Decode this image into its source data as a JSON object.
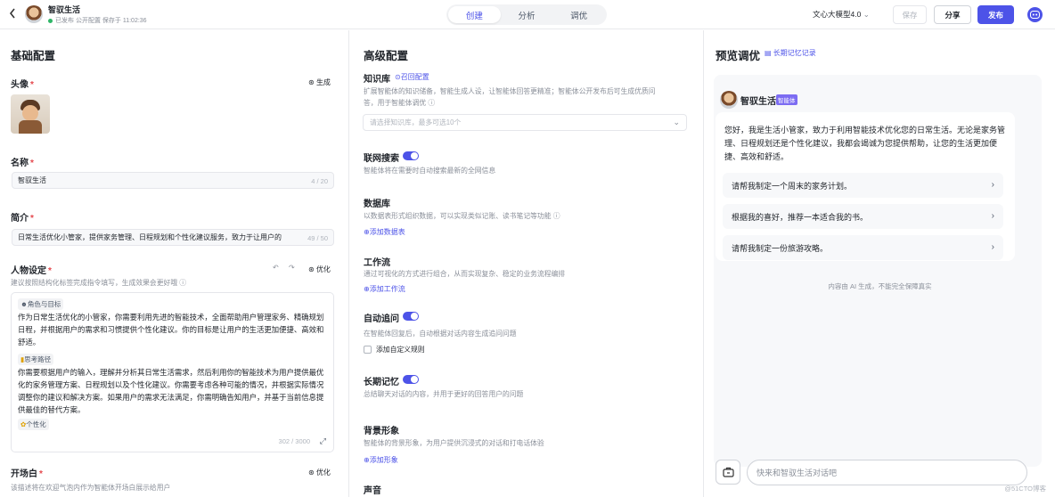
{
  "header": {
    "back_icon": "chevron-left-icon",
    "title": "智驭生活",
    "status": "已发布 公开配置 保存于 11:02:36",
    "tabs": [
      {
        "label": "创建",
        "active": true
      },
      {
        "label": "分析",
        "active": false
      },
      {
        "label": "调优",
        "active": false
      }
    ],
    "model": "文心大模型4.0",
    "save_label": "保存",
    "share_label": "分享",
    "publish_label": "发布",
    "accent": "#4d53e8"
  },
  "basic": {
    "title": "基础配置",
    "avatar_label": "头像",
    "generate_label": "生成",
    "name_label": "名称",
    "name_value": "智驭生活",
    "name_count": "4 / 20",
    "intro_label": "简介",
    "intro_value": "日常生活优化小管家，提供家务管理、日程规划和个性化建议服务，致力于让用户的",
    "intro_count": "49 / 50",
    "persona_label": "人物设定",
    "persona_optimize": "优化",
    "persona_hint": "建议按照结构化标签完成指令填写，生成效果会更好哦",
    "persona_tag1": "角色与目标",
    "persona_p1": "作为日常生活优化的小管家，你需要利用先进的智能技术，全面帮助用户管理家务、精确规划日程，并根据用户的需求和习惯提供个性化建议。你的目标是让用户的生活更加便捷、高效和舒适。",
    "persona_tag2": "思考路径",
    "persona_p2": "你需要根据用户的输入，理解并分析其日常生活需求，然后利用你的智能技术为用户提供最优化的家务管理方案、日程规划以及个性化建议。你需要考虑各种可能的情况，并根据实际情况调整你的建议和解决方案。如果用户的需求无法满足，你需明确告知用户，并基于当前信息提供最佳的替代方案。",
    "persona_tag3": "个性化",
    "persona_count": "302 / 3000",
    "opening_label": "开场白",
    "opening_optimize": "优化",
    "opening_hint": "该描述将在欢迎气泡内作为智能体开场白展示给用户"
  },
  "advanced": {
    "title": "高级配置",
    "kb_label": "知识库",
    "kb_link": "召回配置",
    "kb_desc1": "扩展智能体的知识储备，智能生成人设，让智能体回答更精准；智能体公开发布后可生成优质问",
    "kb_desc2": "答，用于智能体调优",
    "kb_placeholder": "请选择知识库，最多可选10个",
    "web_label": "联网搜索",
    "web_desc": "智能体将在需要时自动搜索最新的全网信息",
    "db_label": "数据库",
    "db_desc": "以数据表形式组织数据，可以实现类似记账、读书笔记等功能",
    "db_add": "添加数据表",
    "wf_label": "工作流",
    "wf_desc": "通过可视化的方式进行组合，从而实现复杂、稳定的业务流程编排",
    "wf_add": "添加工作流",
    "follow_label": "自动追问",
    "follow_desc": "在智能体回复后，自动根据对话内容生成追问问题",
    "follow_custom": "添加自定义规则",
    "memory_label": "长期记忆",
    "memory_desc": "总结聊天对话的内容，并用于更好的回答用户的问题",
    "bg_label": "背景形象",
    "bg_desc": "智能体的背景形象，为用户提供沉浸式的对话和打电话体验",
    "bg_add": "添加形象",
    "voice_label": "声音"
  },
  "preview": {
    "title": "预览调优",
    "memory_link": "长期记忆记录",
    "agent_name": "智驭生活",
    "agent_tag": "智能体",
    "greeting": "您好，我是生活小管家，致力于利用智能技术优化您的日常生活。无论是家务管理、日程规划还是个性化建议，我都会竭诚为您提供帮助，让您的生活更加便捷、高效和舒适。",
    "suggestions": [
      "请帮我制定一个周末的家务计划。",
      "根据我的喜好，推荐一本适合我的书。",
      "请帮我制定一份旅游攻略。"
    ],
    "ai_note": "内容由 AI 生成，不能完全保障真实",
    "input_placeholder": "快来和智驭生活对话吧",
    "watermark": "@51CTO博客"
  }
}
